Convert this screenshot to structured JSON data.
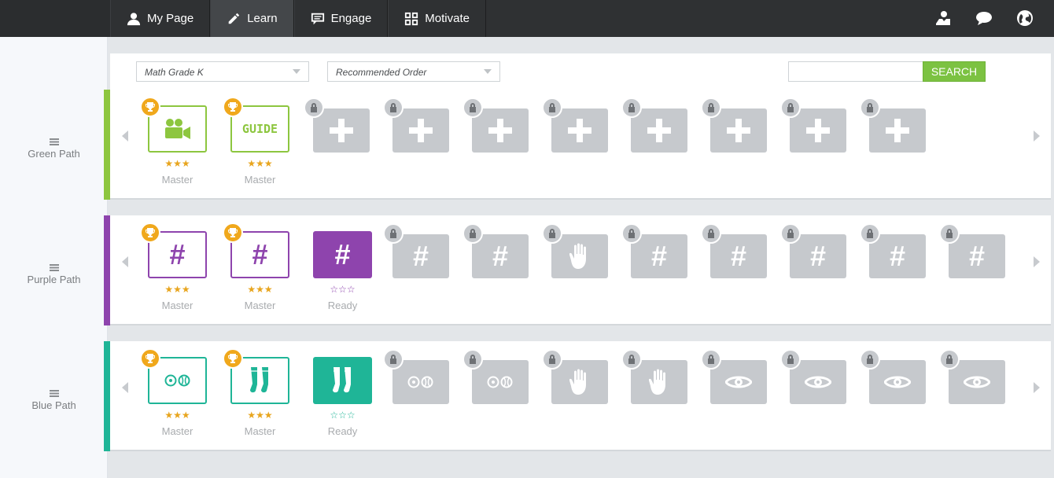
{
  "nav": {
    "tabs": [
      {
        "label": "My Page",
        "icon": "user-icon"
      },
      {
        "label": "Learn",
        "icon": "pencil-icon",
        "active": true
      },
      {
        "label": "Engage",
        "icon": "chat-box-icon"
      },
      {
        "label": "Motivate",
        "icon": "grid-icon"
      }
    ],
    "right_icons": [
      "award-icon",
      "speech-bubble-icon",
      "globe-icon"
    ]
  },
  "sidebar": {
    "items": [
      {
        "label": "Green Path"
      },
      {
        "label": "Purple Path"
      },
      {
        "label": "Blue Path"
      }
    ]
  },
  "filters": {
    "grade_select": "Math Grade K",
    "order_select": "Recommended Order",
    "search_placeholder": "",
    "search_button": "SEARCH"
  },
  "colors": {
    "green": "#8dc63f",
    "purple": "#8e44ad",
    "blue": "#1fb597",
    "trophy": "#f0a81c",
    "locked": "#c6c9cd"
  },
  "paths": [
    {
      "name": "Green Path",
      "color": "#8dc63f",
      "tiles": [
        {
          "type": "video",
          "state": "outline",
          "trophy": true,
          "stars": "★★★",
          "status": "Master"
        },
        {
          "type": "guide",
          "label": "GUIDE",
          "state": "outline",
          "trophy": true,
          "stars": "★★★",
          "status": "Master"
        },
        {
          "type": "plus",
          "state": "locked"
        },
        {
          "type": "plus",
          "state": "locked"
        },
        {
          "type": "plus",
          "state": "locked"
        },
        {
          "type": "plus",
          "state": "locked"
        },
        {
          "type": "plus",
          "state": "locked"
        },
        {
          "type": "plus",
          "state": "locked"
        },
        {
          "type": "plus",
          "state": "locked"
        },
        {
          "type": "plus",
          "state": "locked"
        }
      ]
    },
    {
      "name": "Purple Path",
      "color": "#8e44ad",
      "tiles": [
        {
          "type": "hash",
          "state": "outline",
          "trophy": true,
          "stars": "★★★",
          "status": "Master"
        },
        {
          "type": "hash",
          "state": "outline",
          "trophy": true,
          "stars": "★★★",
          "status": "Master"
        },
        {
          "type": "hash",
          "state": "solid",
          "stars": "☆☆☆",
          "status": "Ready"
        },
        {
          "type": "hash",
          "state": "locked"
        },
        {
          "type": "hash",
          "state": "locked"
        },
        {
          "type": "hand",
          "state": "locked"
        },
        {
          "type": "hash",
          "state": "locked"
        },
        {
          "type": "hash",
          "state": "locked"
        },
        {
          "type": "hash",
          "state": "locked"
        },
        {
          "type": "hash",
          "state": "locked"
        },
        {
          "type": "hash",
          "state": "locked"
        }
      ]
    },
    {
      "name": "Blue Path",
      "color": "#1fb597",
      "tiles": [
        {
          "type": "balls",
          "state": "outline",
          "trophy": true,
          "stars": "★★★",
          "status": "Master"
        },
        {
          "type": "socks",
          "state": "outline",
          "trophy": true,
          "stars": "★★★",
          "status": "Master"
        },
        {
          "type": "socks",
          "state": "solid",
          "stars": "☆☆☆",
          "status": "Ready"
        },
        {
          "type": "balls",
          "state": "locked"
        },
        {
          "type": "balls",
          "state": "locked"
        },
        {
          "type": "hand",
          "state": "locked"
        },
        {
          "type": "hand",
          "state": "locked"
        },
        {
          "type": "eye",
          "state": "locked"
        },
        {
          "type": "eye",
          "state": "locked"
        },
        {
          "type": "eye",
          "state": "locked"
        },
        {
          "type": "eye",
          "state": "locked"
        }
      ]
    }
  ]
}
